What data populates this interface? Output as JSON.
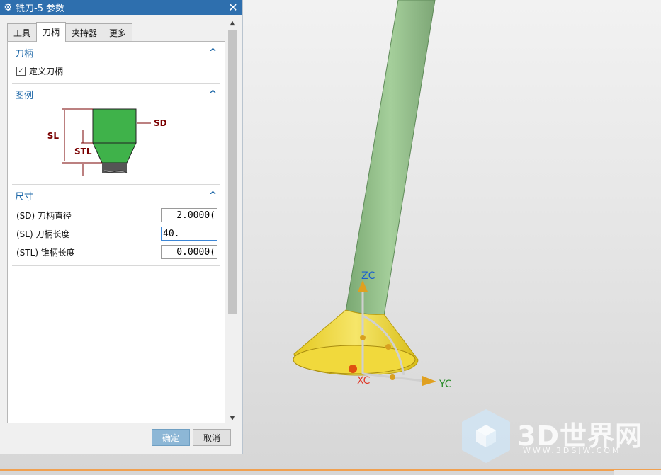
{
  "dialog": {
    "title": "铣刀-5 参数",
    "tabs": [
      "工具",
      "刀柄",
      "夹持器",
      "更多"
    ],
    "active_tab": "刀柄",
    "sections": {
      "holder": {
        "header": "刀柄",
        "checkbox_label": "定义刀柄",
        "checked": true
      },
      "legend": {
        "header": "图例",
        "labels": {
          "sd": "SD",
          "sl": "SL",
          "stl": "STL"
        }
      },
      "dims": {
        "header": "尺寸",
        "rows": [
          {
            "label": "(SD) 刀柄直径",
            "value": "2.0000("
          },
          {
            "label": "(SL) 刀柄长度",
            "value": "40."
          },
          {
            "label": "(STL) 锥柄长度",
            "value": "0.0000("
          }
        ]
      }
    },
    "ok_label": "确定",
    "cancel_label": "取消"
  },
  "viewport": {
    "axis_labels": {
      "z": "ZC",
      "x": "XC",
      "y": "YC"
    },
    "watermark": "3D世界网",
    "watermark_url": "WWW.3DSJW.COM"
  },
  "colors": {
    "accent": "#2e6fae",
    "shank": "#97c28e",
    "cone": "#f0dc3a"
  }
}
